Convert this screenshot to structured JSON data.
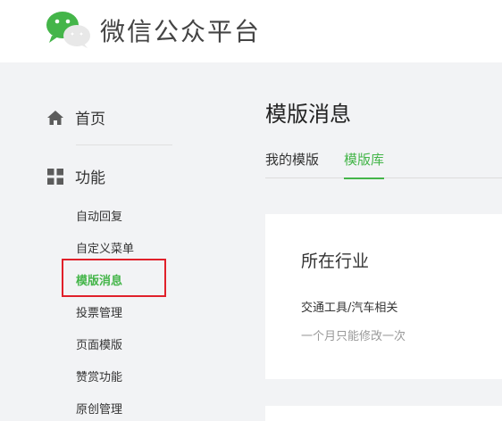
{
  "header": {
    "brand": "微信公众平台",
    "logo_icon": "wechat-logo-icon"
  },
  "sidebar": {
    "home": {
      "icon": "home-icon",
      "label": "首页"
    },
    "function": {
      "icon": "grid-icon",
      "label": "功能"
    },
    "items": [
      {
        "label": "自动回复"
      },
      {
        "label": "自定义菜单"
      },
      {
        "label": "模版消息",
        "active": true
      },
      {
        "label": "投票管理"
      },
      {
        "label": "页面模版"
      },
      {
        "label": "赞赏功能"
      },
      {
        "label": "原创管理"
      }
    ]
  },
  "main": {
    "title": "模版消息",
    "tabs": [
      {
        "label": "我的模版"
      },
      {
        "label": "模版库",
        "active": true
      }
    ],
    "card": {
      "title": "所在行业",
      "industry": "交通工具/汽车相关",
      "hint": "一个月只能修改一次"
    }
  },
  "colors": {
    "accent": "#44b549",
    "highlight": "#e0202a"
  }
}
